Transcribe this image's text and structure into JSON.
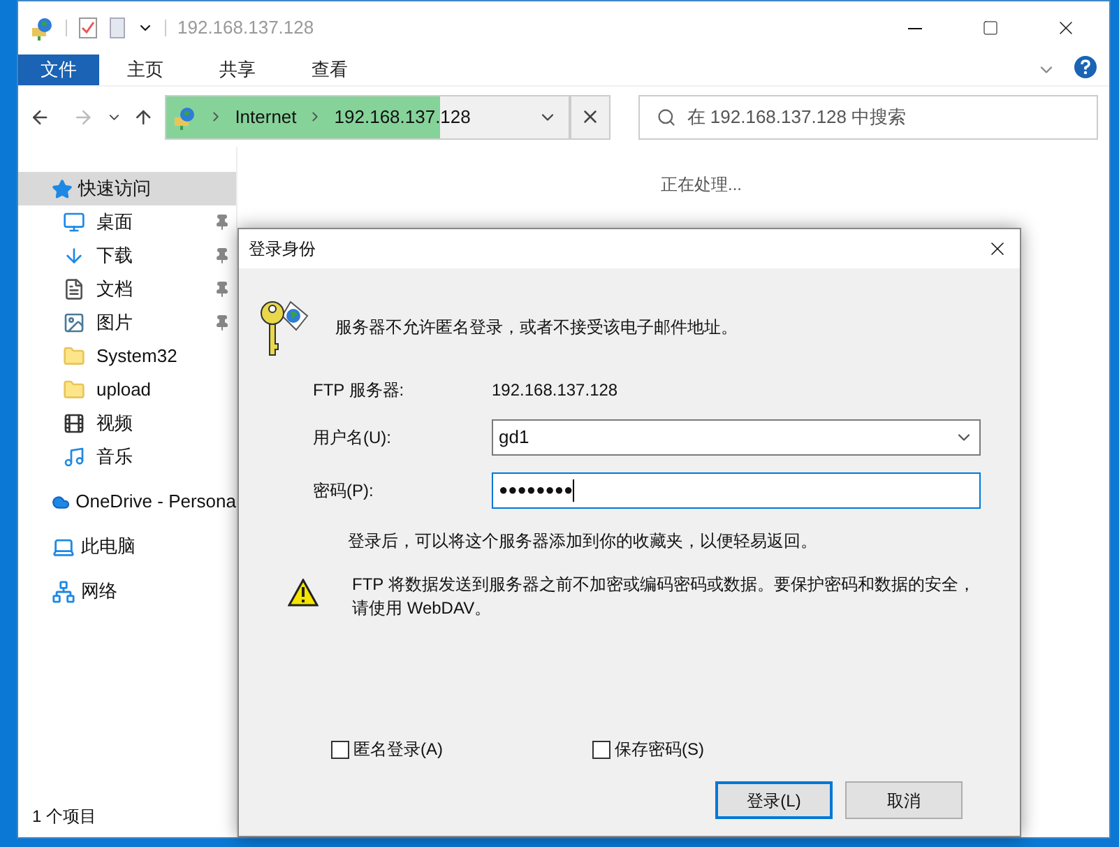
{
  "window": {
    "title": "192.168.137.128"
  },
  "ribbon_tabs": [
    {
      "label": "文件",
      "selected": true
    },
    {
      "label": "主页",
      "selected": false
    },
    {
      "label": "共享",
      "selected": false
    },
    {
      "label": "查看",
      "selected": false
    }
  ],
  "address_bar": {
    "path": [
      "Internet",
      "192.168.137.128"
    ]
  },
  "search": {
    "placeholder": "在 192.168.137.128 中搜索"
  },
  "sidebar": {
    "items": [
      {
        "label": "快速访问",
        "selected": true,
        "children": [
          {
            "label": "桌面",
            "pinned": true
          },
          {
            "label": "下载",
            "pinned": true
          },
          {
            "label": "文档",
            "pinned": true
          },
          {
            "label": "图片",
            "pinned": true
          },
          {
            "label": "System32",
            "pinned": false
          },
          {
            "label": "upload",
            "pinned": false
          },
          {
            "label": "视频",
            "pinned": false
          },
          {
            "label": "音乐",
            "pinned": false
          }
        ]
      },
      {
        "label": "OneDrive - Persona",
        "selected": false
      },
      {
        "label": "此电脑",
        "selected": false
      },
      {
        "label": "网络",
        "selected": false
      }
    ]
  },
  "content": {
    "status_text": "正在处理..."
  },
  "status_bar": {
    "text": "1 个项目"
  },
  "dialog": {
    "title": "登录身份",
    "message": "服务器不允许匿名登录，或者不接受该电子邮件地址。",
    "server_label": "FTP 服务器:",
    "server_value": "192.168.137.128",
    "fields": [
      {
        "label": "用户名(U):",
        "value": "gd1",
        "kind": "combo",
        "focused": false
      },
      {
        "label": "密码(P):",
        "value": "●●●●●●●●",
        "kind": "password",
        "focused": true
      }
    ],
    "note": "登录后，可以将这个服务器添加到你的收藏夹，以便轻易返回。",
    "warning": "FTP 将数据发送到服务器之前不加密或编码密码或数据。要保护密码和数据的安全，请使用 WebDAV。",
    "checkboxes": [
      {
        "label": "匿名登录(A)",
        "checked": false
      },
      {
        "label": "保存密码(S)",
        "checked": false
      }
    ],
    "buttons": [
      {
        "label": "登录(L)",
        "default": true
      },
      {
        "label": "取消",
        "default": false
      }
    ]
  }
}
